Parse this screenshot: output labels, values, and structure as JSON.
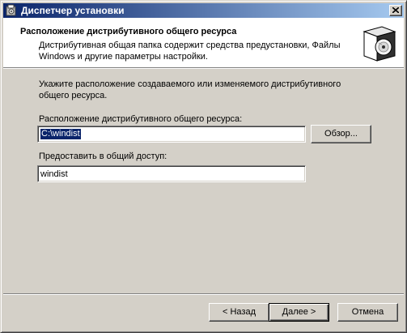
{
  "window": {
    "title": "Диспетчер установки",
    "icon": "setup-manager-icon"
  },
  "header": {
    "title": "Расположение дистрибутивного общего ресурса",
    "description": "Дистрибутивная общая папка содержит средства предустановки, Файлы Windows и другие параметры настройки.",
    "icon": "cd-box-icon"
  },
  "main": {
    "instruction": "Укажите расположение создаваемого или изменяемого дистрибутивного общего ресурса.",
    "path_label": "Расположение дистрибутивного общего ресурса:",
    "path_value": "C:\\windist",
    "browse_label": "Обзор...",
    "share_label": "Предоставить в общий доступ:",
    "share_value": "windist"
  },
  "footer": {
    "back_label": "< Назад",
    "next_label": "Далее >",
    "cancel_label": "Отмена"
  }
}
